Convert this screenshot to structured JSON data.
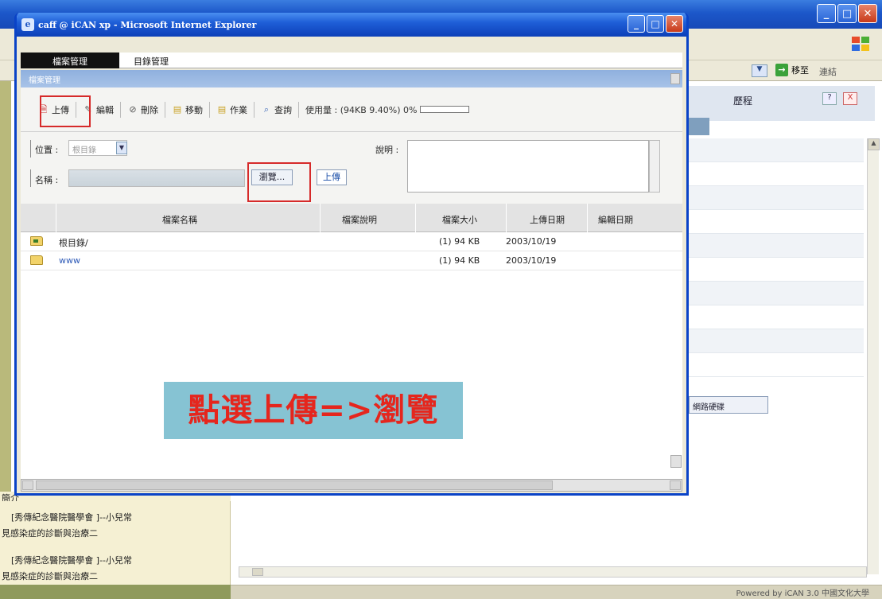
{
  "popup": {
    "title": "caff @ iCAN xp - Microsoft Internet Explorer",
    "tabs": [
      "檔案管理",
      "目錄管理"
    ],
    "section_header": "檔案管理",
    "toolbar": {
      "upload": "上傳",
      "edit": "編輯",
      "delete": "刪除",
      "move": "移動",
      "job": "作業",
      "query": "查詢",
      "usage_text": "使用量 : (94KB 9.40%) 0%",
      "usage_fraction": 0.0
    },
    "form": {
      "location_label": "位置 :",
      "location_value": "根目錄",
      "name_label": "名稱 :",
      "browse_button": "瀏覽...",
      "upload_button": "上傳",
      "description_label": "說明 :"
    },
    "table": {
      "columns": [
        "檔案名稱",
        "檔案說明",
        "檔案大小",
        "上傳日期",
        "編輯日期"
      ],
      "rows": [
        {
          "name": "根目錄/",
          "size": "(1) 94 KB",
          "uploaded": "2003/10/19",
          "is_link": false
        },
        {
          "name": "www",
          "size": "(1) 94 KB",
          "uploaded": "2003/10/19",
          "is_link": true
        }
      ]
    },
    "overlay_caption": "點選上傳=>瀏覽"
  },
  "background": {
    "go_label": "移至",
    "links_label": "連結",
    "panel_title": "歷程",
    "help": "?",
    "close": "X",
    "hdd_button": "網路硬碟",
    "left_heading": "簡介",
    "left_items": [
      "[秀傳紀念醫院醫學會 ]--小兒常",
      "見感染症的診斷與治療二",
      "[秀傳紀念醫院醫學會 ]--小兒常",
      "見感染症的診斷與治療二"
    ],
    "status_right": "Powered by iCAN 3.0 中國文化大學"
  },
  "colors": {
    "highlight": "#d62a2a",
    "overlay_bg": "#86c3d3",
    "overlay_text": "#e5261d",
    "xp_blue": "#1f5fd8"
  }
}
